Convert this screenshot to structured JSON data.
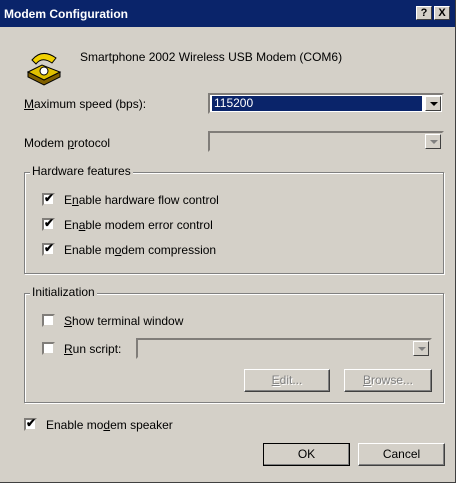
{
  "window": {
    "title": "Modem Configuration",
    "help_label": "?",
    "close_label": "X"
  },
  "device": {
    "name": "Smartphone 2002 Wireless USB Modem (COM6)",
    "icon": "phone-modem-icon"
  },
  "max_speed": {
    "label_underlined": "M",
    "label_rest": "aximum speed (bps):",
    "value": "115200"
  },
  "protocol": {
    "label_pre": "Modem ",
    "label_underlined": "p",
    "label_rest": "rotocol",
    "value": ""
  },
  "hardware": {
    "title": "Hardware features",
    "items": [
      {
        "pre": "E",
        "u": "n",
        "post": "able hardware flow control",
        "checked": true
      },
      {
        "pre": "En",
        "u": "a",
        "post": "ble modem error control",
        "checked": true
      },
      {
        "pre": "Enable m",
        "u": "o",
        "post": "dem compression",
        "checked": true
      }
    ]
  },
  "init": {
    "title": "Initialization",
    "terminal": {
      "u": "S",
      "post": "how terminal window",
      "checked": false
    },
    "script": {
      "u": "R",
      "post": "un script:",
      "checked": false
    },
    "edit_u": "E",
    "edit_rest": "dit...",
    "browse_u": "B",
    "browse_rest": "rowse..."
  },
  "speaker": {
    "pre": "Enable mo",
    "u": "d",
    "post": "em speaker",
    "checked": true
  },
  "buttons": {
    "ok": "OK",
    "cancel": "Cancel"
  },
  "colors": {
    "titlebar": "#0a246a",
    "face": "#d4d0c8",
    "selection": "#0a246a"
  }
}
